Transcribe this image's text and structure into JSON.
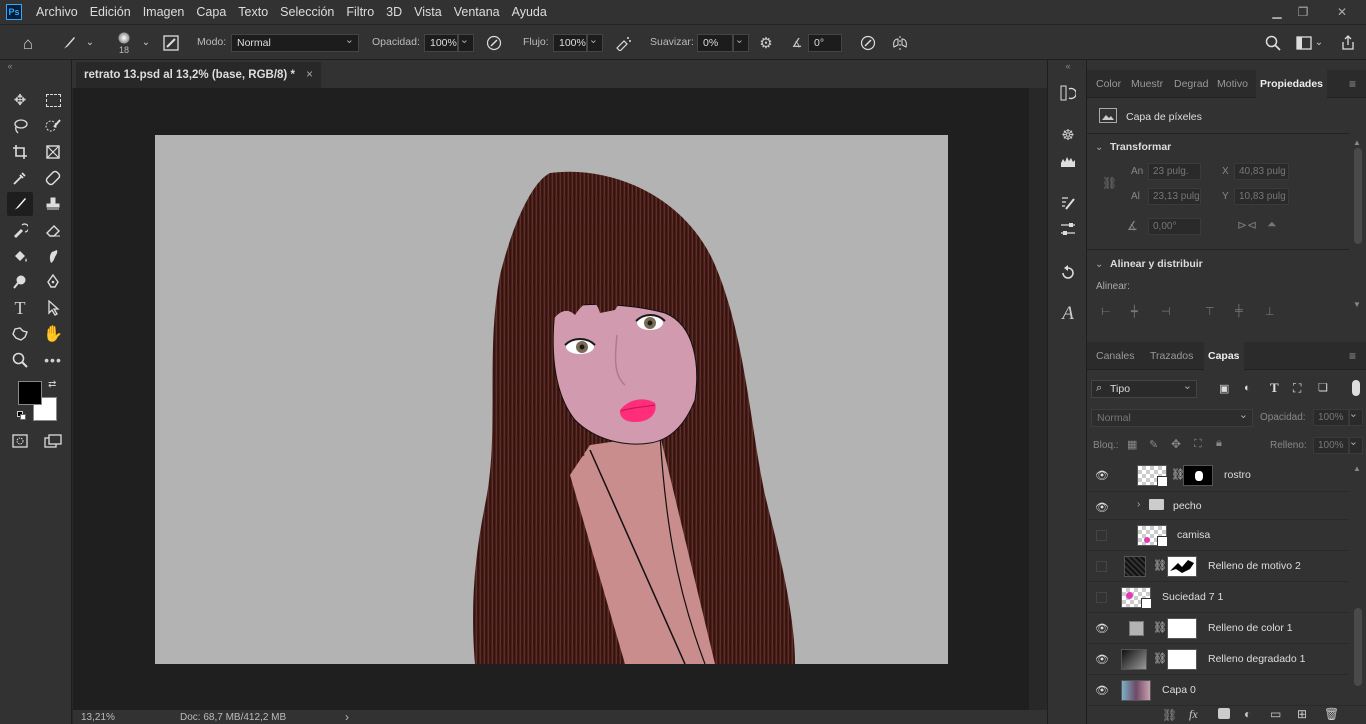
{
  "app": {
    "logo": "Ps"
  },
  "menu": [
    "Archivo",
    "Edición",
    "Imagen",
    "Capa",
    "Texto",
    "Selección",
    "Filtro",
    "3D",
    "Vista",
    "Ventana",
    "Ayuda"
  ],
  "window_controls": {
    "minimize": "minimize-icon",
    "restore": "restore-icon",
    "close": "close-icon"
  },
  "options": {
    "brush_size": "18",
    "mode_label": "Modo:",
    "mode_value": "Normal",
    "opacity_label": "Opacidad:",
    "opacity_value": "100%",
    "flow_label": "Flujo:",
    "flow_value": "100%",
    "smoothing_label": "Suavizar:",
    "smoothing_value": "0%",
    "angle_value": "0°"
  },
  "document": {
    "tab_title": "retrato 13.psd al 13,2% (base, RGB/8) *",
    "close": "×"
  },
  "status": {
    "zoom": "13,21%",
    "doc": "Doc: 68,7 MB/412,2 MB",
    "arrow": "›"
  },
  "properties_panel": {
    "tabs": [
      "Color",
      "Muestr",
      "Degrad",
      "Motivo",
      "Propiedades"
    ],
    "active_tab": "Propiedades",
    "layer_kind": "Capa de píxeles",
    "transform_title": "Transformar",
    "w_label": "An",
    "w_value": "23 pulg.",
    "x_label": "X",
    "x_value": "40,83 pulg",
    "h_label": "Al",
    "h_value": "23,13 pulg",
    "y_label": "Y",
    "y_value": "10,83 pulg",
    "angle_value": "0,00°",
    "align_title": "Alinear y distribuir",
    "align_label": "Alinear:"
  },
  "layers_panel": {
    "tabs": [
      "Canales",
      "Trazados",
      "Capas"
    ],
    "active_tab": "Capas",
    "filter_kind": "Tipo",
    "blend_mode": "Normal",
    "opacity_label": "Opacidad:",
    "opacity_value": "100%",
    "lock_label": "Bloq.:",
    "fill_label": "Relleno:",
    "fill_value": "100%",
    "layers": [
      {
        "name": "rostro",
        "visible": true
      },
      {
        "name": "pecho",
        "visible": true
      },
      {
        "name": "camisa",
        "visible": false
      },
      {
        "name": "Relleno de motivo 2",
        "visible": false
      },
      {
        "name": "Suciedad 7 1",
        "visible": false
      },
      {
        "name": "Relleno de color 1",
        "visible": true
      },
      {
        "name": "Relleno degradado 1",
        "visible": true
      },
      {
        "name": "Capa 0",
        "visible": true
      }
    ]
  },
  "colors": {
    "accent": "#31a8ff",
    "foreground": "#000000",
    "background": "#ffffff"
  }
}
